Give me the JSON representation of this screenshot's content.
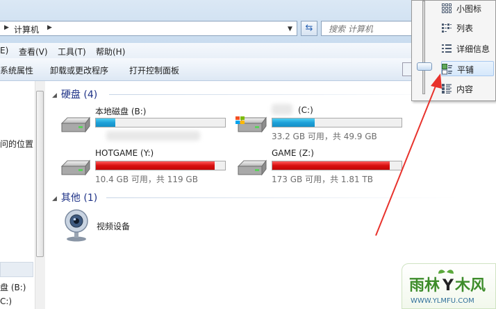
{
  "address_bar": {
    "path": [
      "计算机"
    ],
    "search_placeholder": "搜索 计算机"
  },
  "menu": {
    "items": [
      "E)",
      "查看(V)",
      "工具(T)",
      "帮助(H)"
    ]
  },
  "toolbar": {
    "items": [
      "系统属性",
      "卸载或更改程序",
      "打开控制面板"
    ]
  },
  "nav_pane": {
    "texts": [
      "问的位置",
      "盘 (B:)",
      "C:)"
    ]
  },
  "groups": {
    "hard_disks": {
      "title": "硬盘 (4)"
    },
    "other": {
      "title": "其他 (1)"
    }
  },
  "drives": [
    {
      "name": "本地磁盘 (B:)",
      "size_text": "",
      "used_fraction": 0.15,
      "bar_color": "#1fa0d8"
    },
    {
      "name": "(C:)",
      "size_text": "33.2 GB 可用，共 49.9 GB",
      "used_fraction": 0.33,
      "bar_color": "#1fa0d8"
    },
    {
      "name": "HOTGAME (Y:)",
      "size_text": "10.4 GB 可用，共 119 GB",
      "used_fraction": 0.92,
      "bar_color": "#d81010"
    },
    {
      "name": "GAME (Z:)",
      "size_text": "173 GB 可用，共 1.81 TB",
      "used_fraction": 0.91,
      "bar_color": "#d81010"
    }
  ],
  "devices": [
    {
      "name": "视频设备"
    }
  ],
  "view_menu": {
    "items": [
      {
        "label": "小图标",
        "icon": "small-icons-icon"
      },
      {
        "label": "列表",
        "icon": "list-view-icon"
      },
      {
        "label": "详细信息",
        "icon": "details-view-icon"
      },
      {
        "label": "平铺",
        "icon": "tiles-view-icon",
        "selected": true
      },
      {
        "label": "内容",
        "icon": "content-view-icon"
      }
    ]
  },
  "watermark": {
    "line1_left": "雨林",
    "line1_mid": "Y",
    "line1_right": "木风",
    "line2": "WWW.YLMFU.COM"
  },
  "colors": {
    "accent": "#1e3287",
    "bar_free": "#1fa0d8",
    "bar_full": "#d81010",
    "annotation_arrow": "#e8322c",
    "watermark_text": "#3d8c2a"
  }
}
